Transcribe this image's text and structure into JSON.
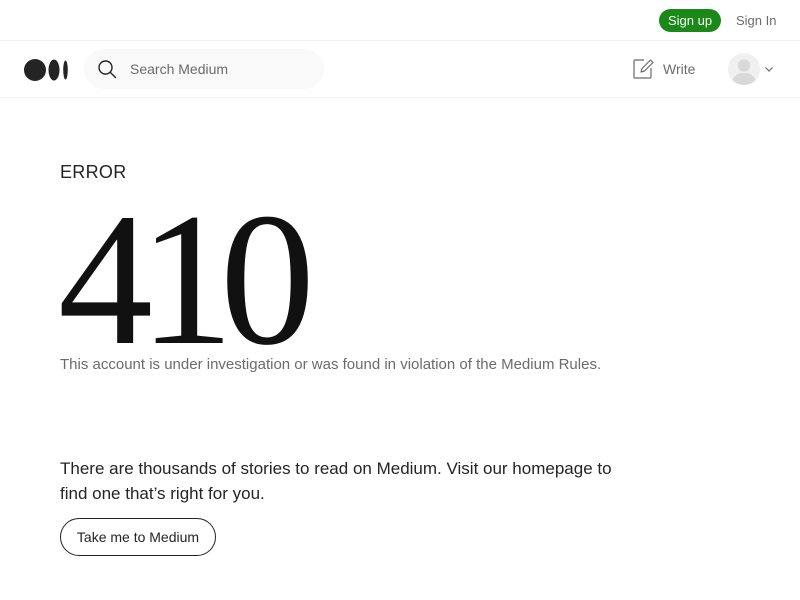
{
  "topbar": {
    "signup_label": "Sign up",
    "signin_label": "Sign In"
  },
  "navbar": {
    "logo_icon": "medium-logo-icon",
    "search": {
      "placeholder": "Search Medium",
      "value": ""
    },
    "write_label": "Write",
    "avatar_icon": "user-avatar-icon"
  },
  "error": {
    "label": "ERROR",
    "code": "410",
    "message": "This account is under investigation or was found in violation of the Medium Rules."
  },
  "promo": {
    "text": "There are thousands of stories to read on Medium. Visit our homepage to find one that’s right for you.",
    "button_label": "Take me to Medium"
  },
  "colors": {
    "signup_bg": "#1a8917",
    "text_primary": "#242424",
    "text_muted": "#6b6b6b",
    "search_bg": "#f9f9f9"
  }
}
